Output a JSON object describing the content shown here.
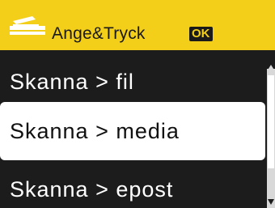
{
  "header": {
    "title": "Ange&Tryck",
    "ok_label": "OK",
    "icon": "scan-icon",
    "background_color": "#f4cf1a"
  },
  "menu": {
    "items": [
      {
        "label": "Skanna > fil"
      },
      {
        "label": "Skanna > media",
        "selected": true
      },
      {
        "label": "Skanna > epost"
      }
    ]
  }
}
